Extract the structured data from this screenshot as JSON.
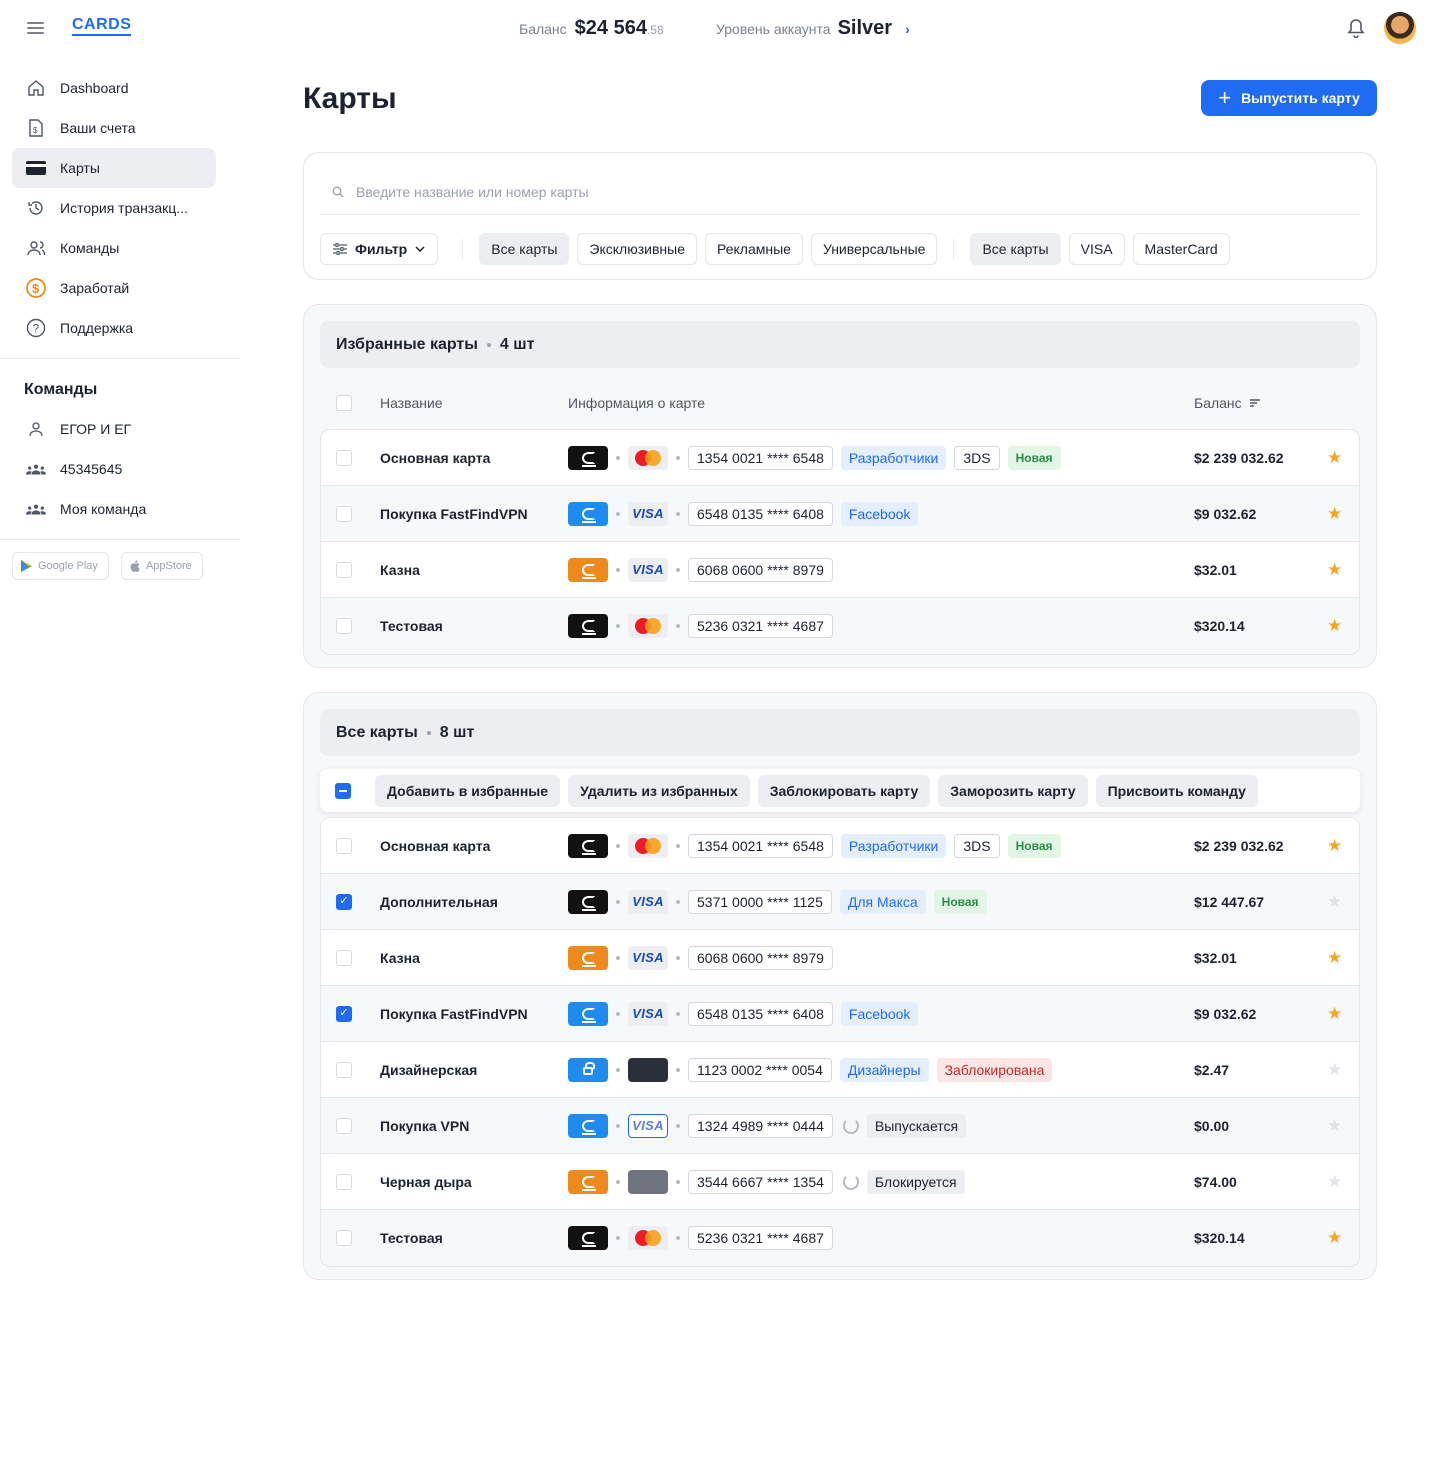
{
  "header": {
    "logo": "CARDS",
    "balance_label": "Баланс",
    "balance_main": "$24 564",
    "balance_cents": ".58",
    "level_label": "Уровень аккаунта",
    "level_value": "Silver"
  },
  "sidebar": {
    "items": [
      {
        "label": "Dashboard",
        "icon": "home-icon"
      },
      {
        "label": "Ваши счета",
        "icon": "document-icon"
      },
      {
        "label": "Карты",
        "icon": "card-icon",
        "active": true
      },
      {
        "label": "История транзакц...",
        "icon": "history-icon"
      },
      {
        "label": "Команды",
        "icon": "team-icon"
      },
      {
        "label": "Заработай",
        "icon": "dollar-icon"
      },
      {
        "label": "Поддержка",
        "icon": "help-icon"
      }
    ],
    "teams_title": "Команды",
    "teams": [
      {
        "label": "ЕГОР И ЕГ",
        "icon": "user-icon"
      },
      {
        "label": "45345645",
        "icon": "group-icon"
      },
      {
        "label": "Моя команда",
        "icon": "group-icon"
      }
    ],
    "stores": [
      "Google Play",
      "AppStore"
    ]
  },
  "page": {
    "title": "Карты",
    "issue_button": "Выпустить карту"
  },
  "search": {
    "placeholder": "Введите название или номер карты",
    "filter_label": "Фильтр",
    "type_chips": [
      "Все карты",
      "Эксклюзивные",
      "Рекламные",
      "Универсальные"
    ],
    "network_chips": [
      "Все карты",
      "VISA",
      "MasterCard"
    ]
  },
  "favorites": {
    "title": "Избранные карты",
    "count": "4 шт",
    "col_name": "Название",
    "col_info": "Информация о карте",
    "col_balance": "Баланс",
    "rows": [
      {
        "name": "Основная карта",
        "number": "1354 0021 **** 6548",
        "tags": [
          "Разработчики",
          "3DS",
          "Новая"
        ],
        "balance": "$2 239 032.62"
      },
      {
        "name": "Покупка FastFindVPN",
        "number": "6548 0135 **** 6408",
        "tags": [
          "Facebook"
        ],
        "balance": "$9 032.62"
      },
      {
        "name": "Казна",
        "number": "6068 0600 **** 8979",
        "tags": [],
        "balance": "$32.01"
      },
      {
        "name": "Тестовая",
        "number": "5236 0321 **** 4687",
        "tags": [],
        "balance": "$320.14"
      }
    ]
  },
  "all_cards": {
    "title": "Все карты",
    "count": "8 шт",
    "actions": [
      "Добавить в избранные",
      "Удалить из избранных",
      "Заблокировать карту",
      "Заморозить карту",
      "Присвоить команду"
    ],
    "rows": [
      {
        "name": "Основная карта",
        "number": "1354 0021 **** 6548",
        "tags": [
          "Разработчики",
          "3DS",
          "Новая"
        ],
        "balance": "$2 239 032.62"
      },
      {
        "name": "Дополнительная",
        "number": "5371 0000 **** 1125",
        "tags": [
          "Для Макса",
          "Новая"
        ],
        "balance": "$12 447.67"
      },
      {
        "name": "Казна",
        "number": "6068 0600 **** 8979",
        "tags": [],
        "balance": "$32.01"
      },
      {
        "name": "Покупка FastFindVPN",
        "number": "6548 0135 **** 6408",
        "tags": [
          "Facebook"
        ],
        "balance": "$9 032.62"
      },
      {
        "name": "Дизайнерская",
        "number": "1123 0002 **** 0054",
        "tags": [
          "Дизайнеры",
          "Заблокирована"
        ],
        "balance": "$2.47"
      },
      {
        "name": "Покупка VPN",
        "number": "1324 4989 **** 0444",
        "tags": [
          "Выпускается"
        ],
        "balance": "$0.00"
      },
      {
        "name": "Черная дыра",
        "number": "3544 6667 **** 1354",
        "tags": [
          "Блокируется"
        ],
        "balance": "$74.00"
      },
      {
        "name": "Тестовая",
        "number": "5236 0321 **** 4687",
        "tags": [],
        "balance": "$320.14"
      }
    ]
  },
  "colors": {
    "accent": "#1f6bf1",
    "star": "#f5a524",
    "success": "#2b8a46",
    "danger": "#c22a2a"
  }
}
